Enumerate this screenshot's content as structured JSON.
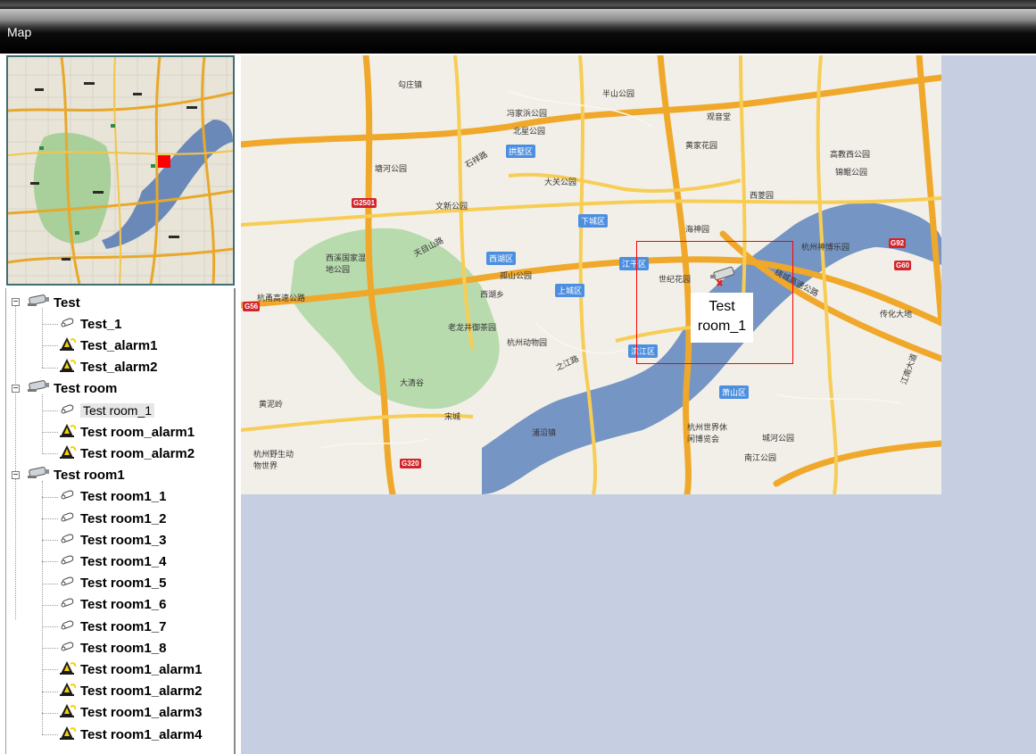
{
  "window": {
    "title": "Map"
  },
  "overview": {
    "marker_color": "#ff0000"
  },
  "tree": {
    "groups": [
      {
        "label": "Test",
        "expander": "⊟",
        "children": [
          {
            "label": "Test_1",
            "kind": "camera"
          },
          {
            "label": "Test_alarm1",
            "kind": "alarm"
          },
          {
            "label": "Test_alarm2",
            "kind": "alarm"
          }
        ]
      },
      {
        "label": "Test room",
        "expander": "⊟",
        "children": [
          {
            "label": "Test room_1",
            "kind": "camera",
            "selected": true
          },
          {
            "label": "Test room_alarm1",
            "kind": "alarm"
          },
          {
            "label": "Test room_alarm2",
            "kind": "alarm"
          }
        ]
      },
      {
        "label": "Test room1",
        "expander": "⊟",
        "children": [
          {
            "label": "Test room1_1",
            "kind": "camera"
          },
          {
            "label": "Test room1_2",
            "kind": "camera"
          },
          {
            "label": "Test room1_3",
            "kind": "camera"
          },
          {
            "label": "Test room1_4",
            "kind": "camera"
          },
          {
            "label": "Test room1_5",
            "kind": "camera"
          },
          {
            "label": "Test room1_6",
            "kind": "camera"
          },
          {
            "label": "Test room1_7",
            "kind": "camera"
          },
          {
            "label": "Test room1_8",
            "kind": "camera"
          },
          {
            "label": "Test room1_alarm1",
            "kind": "alarm"
          },
          {
            "label": "Test room1_alarm2",
            "kind": "alarm"
          },
          {
            "label": "Test room1_alarm3",
            "kind": "alarm"
          },
          {
            "label": "Test room1_alarm4",
            "kind": "alarm"
          }
        ]
      }
    ]
  },
  "map": {
    "device_label": "Test\nroom_1",
    "device_status_icon": "x-mark-icon",
    "pois": [
      "勾庄镇",
      "半山公园",
      "冯家浜公园",
      "北星公园",
      "观音堂",
      "黄家花园",
      "塘河公园",
      "大关公园",
      "文新公园",
      "西溪国家湿地公园",
      "西湖乡",
      "孤山公园",
      "世纪花园",
      "杭州神博乐园",
      "老龙井御茶园",
      "杭州动物园",
      "大清谷",
      "黄泥岭",
      "宋城",
      "浦沿镇",
      "杭州世界休闲博览会",
      "城河公园",
      "南江公园",
      "杭州野生动物世界",
      "锦鲲公园",
      "高教西公园",
      "西菱园",
      "海神园",
      "传化大地",
      "杭甬高速公路",
      "绕城高速公路",
      "天目山路",
      "石祥路",
      "江南大道",
      "之江路"
    ],
    "districts": [
      "拱墅区",
      "下城区",
      "西湖区",
      "江干区",
      "上城区",
      "滨江区",
      "萧山区"
    ],
    "highways": [
      "G2501",
      "G56",
      "G92",
      "G60",
      "G320"
    ]
  },
  "colors": {
    "background": "#c6cfe1",
    "selection": "#e6e6e6",
    "device_box": "#ff0000"
  }
}
